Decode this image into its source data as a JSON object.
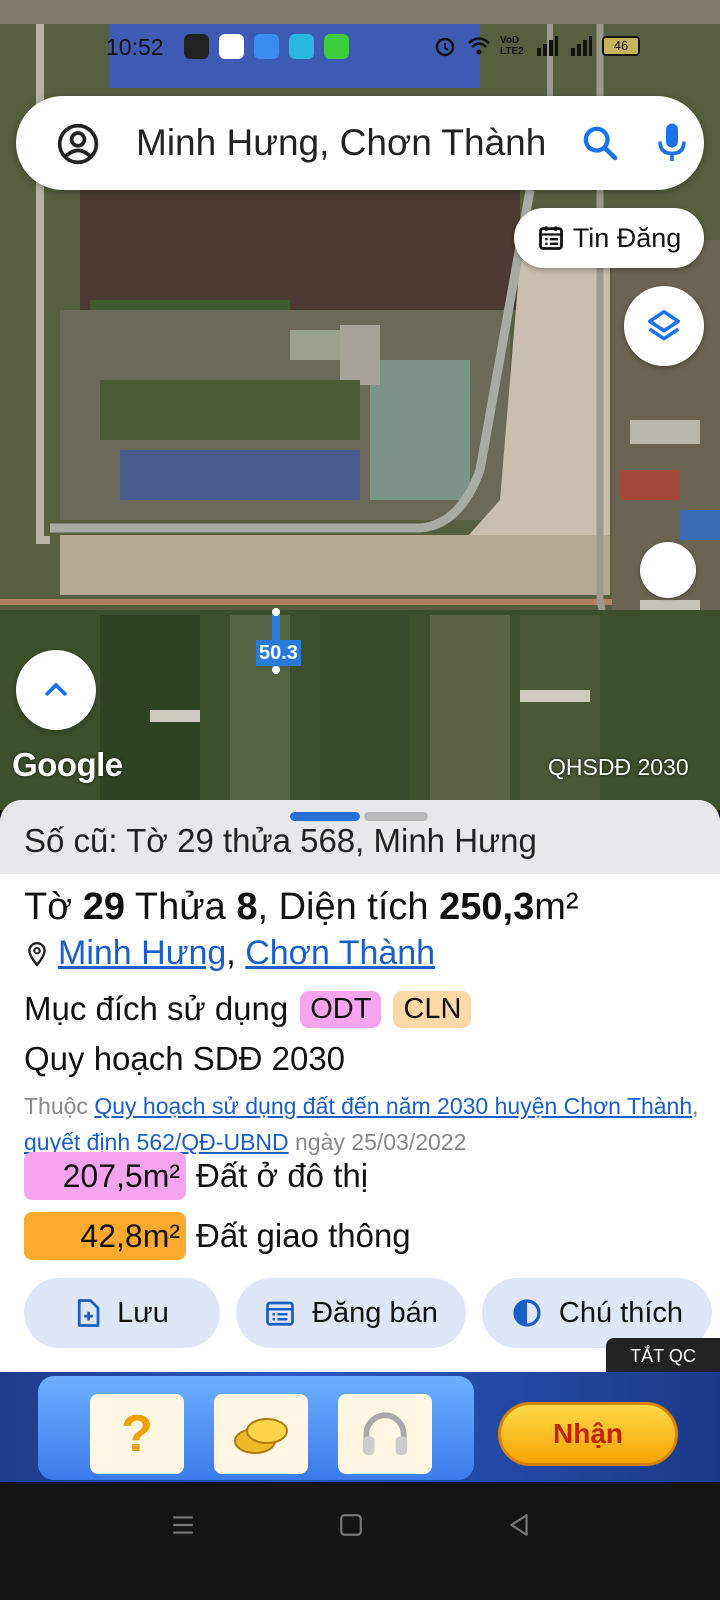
{
  "status_bar": {
    "time": "10:52",
    "battery": "46",
    "network_label": "VoD LTE2"
  },
  "search": {
    "query": "Minh Hưng, Chơn Thành",
    "account_icon": "account-circle-icon",
    "search_icon": "search-icon",
    "mic_icon": "mic-icon"
  },
  "map": {
    "tin_dang_label": "Tin Đăng",
    "parcel_label": "50.3",
    "google_label": "Google",
    "layer_label": "QHSDĐ 2030"
  },
  "sheet": {
    "old_id": "Số cũ: Tờ 29 thửa 568, Minh Hưng",
    "parcel": {
      "sheet_prefix": "Tờ ",
      "sheet_no": "29",
      "plot_prefix": " Thửa ",
      "plot_no": "8",
      "area_prefix": ", Diện tích ",
      "area_value": "250,3",
      "area_unit": "m²"
    },
    "location": {
      "ward": "Minh Hưng",
      "separator": ", ",
      "district": "Chơn Thành"
    },
    "purpose_label": "Mục đích sử dụng",
    "purpose_tags": [
      "ODT",
      "CLN"
    ],
    "plan_title": "Quy hoạch SDĐ 2030",
    "plan_desc": {
      "prefix": "Thuộc ",
      "plan_link": "Quy hoạch sử dụng đất đến năm 2030 huyện Chơn Thành",
      "sep": ", ",
      "decision_link": "quyết định 562/QĐ-UBND",
      "date_text": " ngày 25/03/2022"
    },
    "areas": [
      {
        "value": "207,5m²",
        "label": "Đất ở đô thị",
        "color": "#f5a5f0"
      },
      {
        "value": "42,8m²",
        "label": "Đất giao thông",
        "color": "#ffa92e"
      }
    ],
    "actions": {
      "save": "Lưu",
      "sell": "Đăng bán",
      "legend": "Chú thích"
    }
  },
  "ad": {
    "close_label": "TẮT QC",
    "cta_label": "Nhận",
    "tile_question": "?"
  },
  "colors": {
    "accent": "#1a5fc8",
    "button_bg": "#dfe7f7",
    "tag_odt": "#f5a5f0",
    "tag_cln": "#ffd8a8"
  }
}
